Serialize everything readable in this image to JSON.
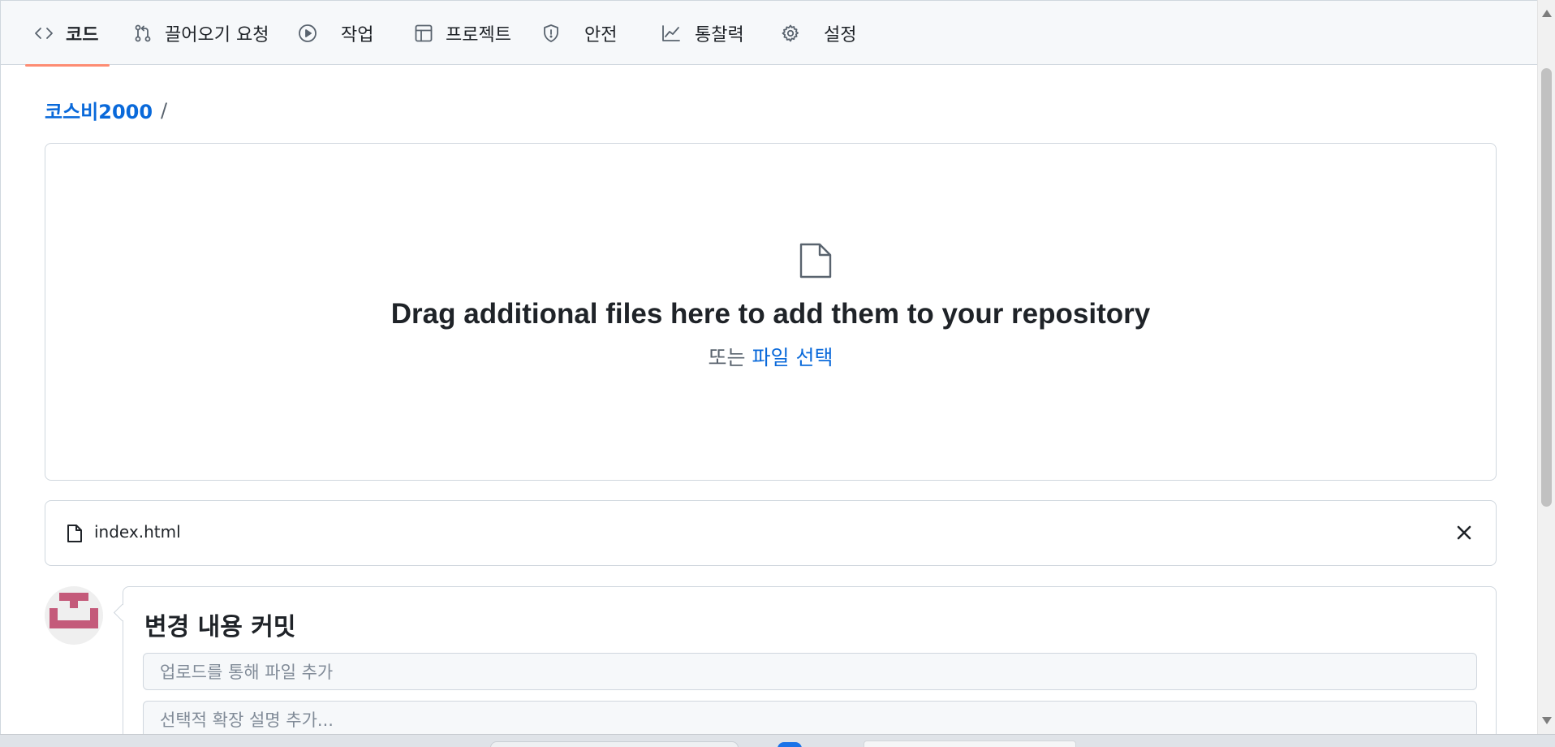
{
  "nav": {
    "tabs": [
      {
        "label": "코드",
        "icon": "code-icon",
        "active": true
      },
      {
        "label": "끌어오기 요청",
        "icon": "pull-request-icon"
      },
      {
        "label": "작업",
        "icon": "play-icon"
      },
      {
        "label": "프로젝트",
        "icon": "table-icon"
      },
      {
        "label": "안전",
        "icon": "shield-icon"
      },
      {
        "label": "통찰력",
        "icon": "graph-icon"
      },
      {
        "label": "설정",
        "icon": "gear-icon"
      }
    ]
  },
  "breadcrumb": {
    "owner": "코스비2000",
    "separator": "/"
  },
  "dropzone": {
    "icon": "file-icon",
    "title": "Drag additional files here to add them to your repository",
    "sub_prefix": "또는",
    "sub_link": "파일 선택"
  },
  "file": {
    "name": "index.html",
    "icon": "file-icon",
    "remove_icon": "close-icon"
  },
  "commit": {
    "title": "변경 내용 커밋",
    "summary_placeholder": "업로드를 통해 파일 추가",
    "description_placeholder": "선택적 확장 설명 추가..."
  },
  "colors": {
    "accent": "#0969da",
    "tab_underline": "#fd8c73",
    "avatar": "#c45a7a"
  }
}
